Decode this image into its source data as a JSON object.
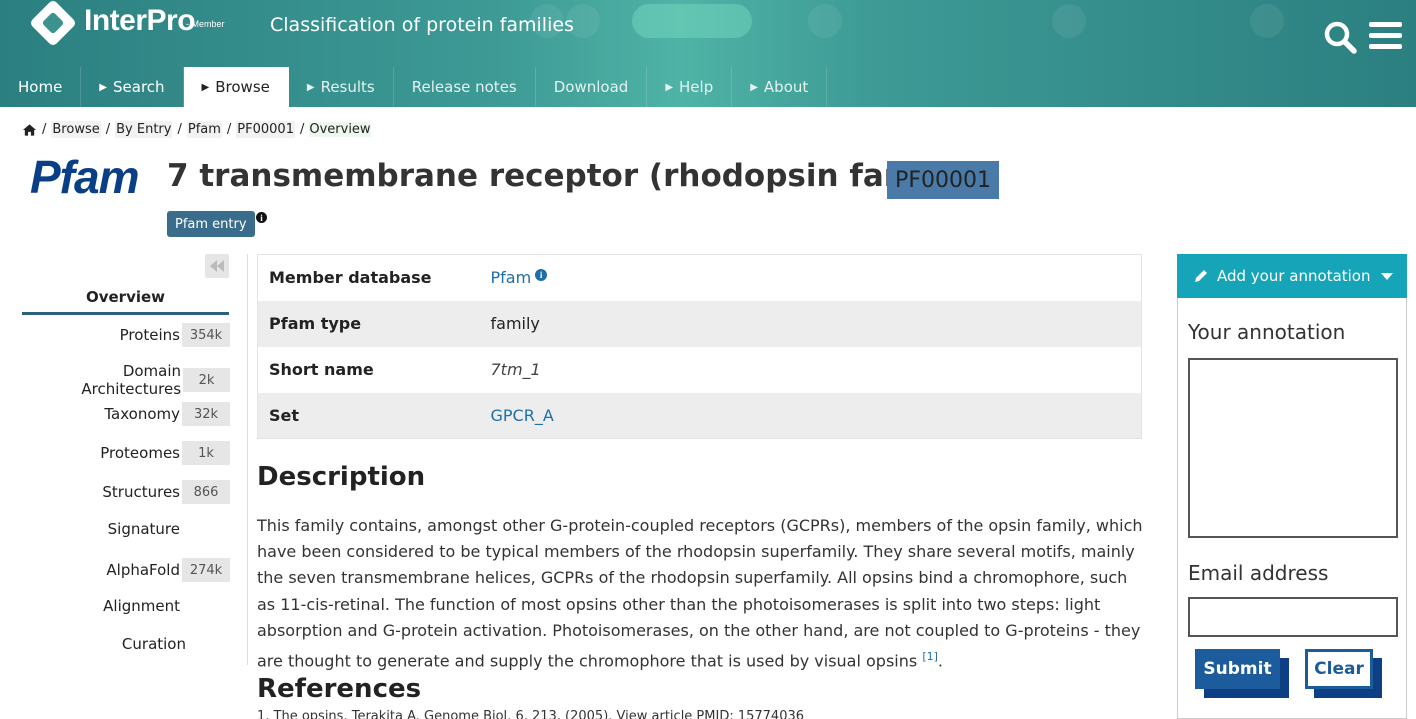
{
  "header": {
    "logo_text": "InterPro",
    "logo_sub": "- Member",
    "tagline": "Classification of protein families",
    "colors": {
      "header_teal": "#3d9a95",
      "accent_blue": "#1d6fa8",
      "dark_navy": "#0a3f86",
      "annotation_teal": "#16a4b8"
    }
  },
  "nav": {
    "items": [
      {
        "label": "Home",
        "caret": false,
        "active": false
      },
      {
        "label": "Search",
        "caret": true,
        "active": false
      },
      {
        "label": "Browse",
        "caret": true,
        "active": true
      },
      {
        "label": "Results",
        "caret": true,
        "active": false
      },
      {
        "label": "Release notes",
        "caret": false,
        "active": false
      },
      {
        "label": "Download",
        "caret": false,
        "active": false
      },
      {
        "label": "Help",
        "caret": true,
        "active": false
      },
      {
        "label": "About",
        "caret": true,
        "active": false
      }
    ]
  },
  "breadcrumb": {
    "sep": "/",
    "items": [
      "Browse",
      "By Entry",
      "Pfam",
      "PF00001",
      "Overview"
    ]
  },
  "entry": {
    "db_logo": "Pfam",
    "title": "7 transmembrane receptor (rhodopsin family)",
    "accession": "PF00001",
    "badge": "Pfam entry",
    "info_glyph": "i"
  },
  "side_menu": {
    "overview": "Overview",
    "tabs": [
      {
        "label": "Proteins",
        "count": "354k"
      },
      {
        "label": "Domain Architectures",
        "count": "2k"
      },
      {
        "label": "Taxonomy",
        "count": "32k"
      },
      {
        "label": "Proteomes",
        "count": "1k"
      },
      {
        "label": "Structures",
        "count": "866"
      },
      {
        "label": "Signature",
        "count": ""
      },
      {
        "label": "AlphaFold",
        "count": "274k"
      },
      {
        "label": "Alignment",
        "count": ""
      },
      {
        "label": "Curation",
        "count": ""
      }
    ]
  },
  "metadata": {
    "rows": [
      {
        "key": "Member database",
        "value": "Pfam"
      },
      {
        "key": "Pfam type",
        "value": "family"
      },
      {
        "key": "Short name",
        "value": "7tm_1"
      },
      {
        "key": "Set",
        "value": "GPCR_A"
      }
    ]
  },
  "description": {
    "heading": "Description",
    "text": "This family contains, amongst other G-protein-coupled receptors (GCPRs), members of the opsin family, which have been considered to be typical members of the rhodopsin superfamily. They share several motifs, mainly the seven transmembrane helices, GCPRs of the rhodopsin superfamily. All opsins bind a chromophore, such as 11-cis-retinal. The function of most opsins other than the photoisomerases is split into two steps: light absorption and G-protein activation. Photoisomerases, on the other hand, are not coupled to G-proteins - they are thought to generate and supply the chromophore that is used by visual opsins",
    "citation": "[1]",
    "end": "."
  },
  "references": {
    "heading": "References",
    "first": "1. The opsins. Terakita A. Genome Biol. 6, 213, (2005). View article  PMID: 15774036"
  },
  "annotation": {
    "header": "Add your annotation",
    "label_annotation": "Your annotation",
    "label_email": "Email address",
    "submit": "Submit",
    "clear": "Clear"
  }
}
